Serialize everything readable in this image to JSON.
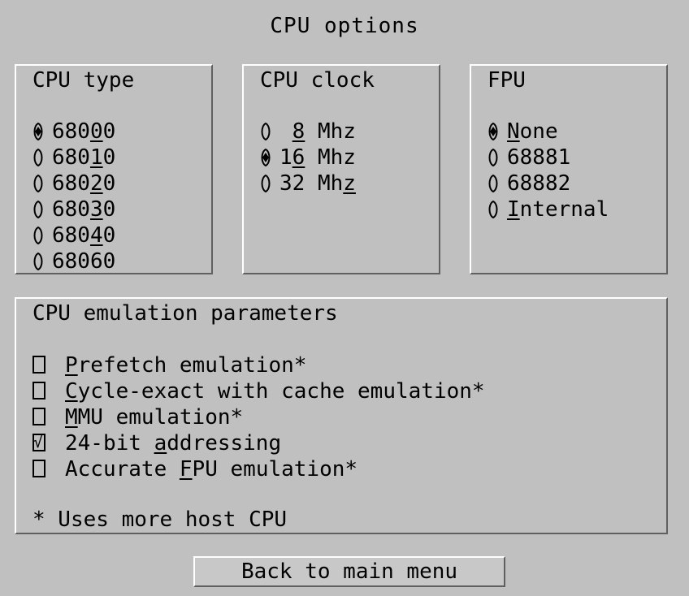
{
  "window": {
    "title": "CPU options"
  },
  "cpu_type": {
    "title": "CPU type",
    "options": [
      {
        "pre": "680",
        "u": "0",
        "post": "0",
        "selected": true
      },
      {
        "pre": "680",
        "u": "1",
        "post": "0",
        "selected": false
      },
      {
        "pre": "680",
        "u": "2",
        "post": "0",
        "selected": false
      },
      {
        "pre": "680",
        "u": "3",
        "post": "0",
        "selected": false
      },
      {
        "pre": "680",
        "u": "4",
        "post": "0",
        "selected": false
      },
      {
        "pre": "68060",
        "u": "",
        "post": "",
        "selected": false
      }
    ]
  },
  "cpu_clock": {
    "title": "CPU clock",
    "options": [
      {
        "pre": " ",
        "u": "8",
        "post": " Mhz",
        "selected": false
      },
      {
        "pre": "1",
        "u": "6",
        "post": " Mhz",
        "selected": true
      },
      {
        "pre": "32 Mh",
        "u": "z",
        "post": "",
        "selected": false
      }
    ]
  },
  "fpu": {
    "title": "FPU",
    "options": [
      {
        "pre": "",
        "u": "N",
        "post": "one",
        "selected": true
      },
      {
        "pre": "68881",
        "u": "",
        "post": "",
        "selected": false
      },
      {
        "pre": "68882",
        "u": "",
        "post": "",
        "selected": false
      },
      {
        "pre": "",
        "u": "I",
        "post": "nternal",
        "selected": false
      }
    ]
  },
  "emulation": {
    "title": "CPU emulation parameters",
    "options": [
      {
        "pre": "",
        "u": "P",
        "post": "refetch emulation*",
        "checked": false
      },
      {
        "pre": "",
        "u": "C",
        "post": "ycle-exact with cache emulation*",
        "checked": false
      },
      {
        "pre": "",
        "u": "M",
        "post": "MU emulation*",
        "checked": false
      },
      {
        "pre": "24-bit ",
        "u": "a",
        "post": "ddressing",
        "checked": true
      },
      {
        "pre": "Accurate ",
        "u": "F",
        "post": "PU emulation*",
        "checked": false
      }
    ],
    "note": "* Uses more host CPU"
  },
  "footer": {
    "back_label": "Back to main menu"
  }
}
